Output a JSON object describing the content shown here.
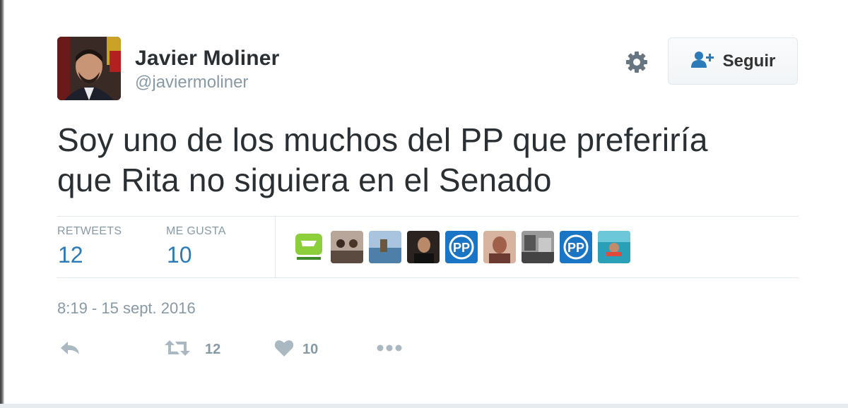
{
  "tweet": {
    "author": {
      "name": "Javier Moliner",
      "handle": "@javiermoliner",
      "avatar_icon": "profile-photo"
    },
    "follow_button": {
      "label": "Seguir",
      "icon": "add-user-icon"
    },
    "settings_icon": "gear-icon",
    "text_lines": [
      "Soy uno de los muchos del PP que preferiría",
      "que Rita no siguiera en el Senado"
    ],
    "stats": {
      "retweets_label": "RETWEETS",
      "retweets_value": "12",
      "likes_label": "ME GUSTA",
      "likes_value": "10"
    },
    "likers": [
      {
        "name": "liker-avatar-1",
        "color": "#8ccf3a"
      },
      {
        "name": "liker-avatar-2",
        "color": "#6b5a52"
      },
      {
        "name": "liker-avatar-3",
        "color": "#4e7fa8"
      },
      {
        "name": "liker-avatar-4",
        "color": "#2a2320"
      },
      {
        "name": "liker-avatar-pp-1",
        "color": "#1a75c4"
      },
      {
        "name": "liker-avatar-6",
        "color": "#a0604a"
      },
      {
        "name": "liker-avatar-7",
        "color": "#777777"
      },
      {
        "name": "liker-avatar-pp-2",
        "color": "#1a75c4"
      },
      {
        "name": "liker-avatar-9",
        "color": "#2aa0b8"
      }
    ],
    "timestamp": "8:19 - 15 sept. 2016",
    "actions": {
      "reply_icon": "reply-icon",
      "retweet_icon": "retweet-icon",
      "retweet_count": "12",
      "like_icon": "heart-icon",
      "like_count": "10",
      "more_icon": "more-icon"
    },
    "colors": {
      "link": "#2b7bb9",
      "muted": "#8899a6",
      "text": "#292f33",
      "pp_blue": "#1a75c4"
    }
  }
}
